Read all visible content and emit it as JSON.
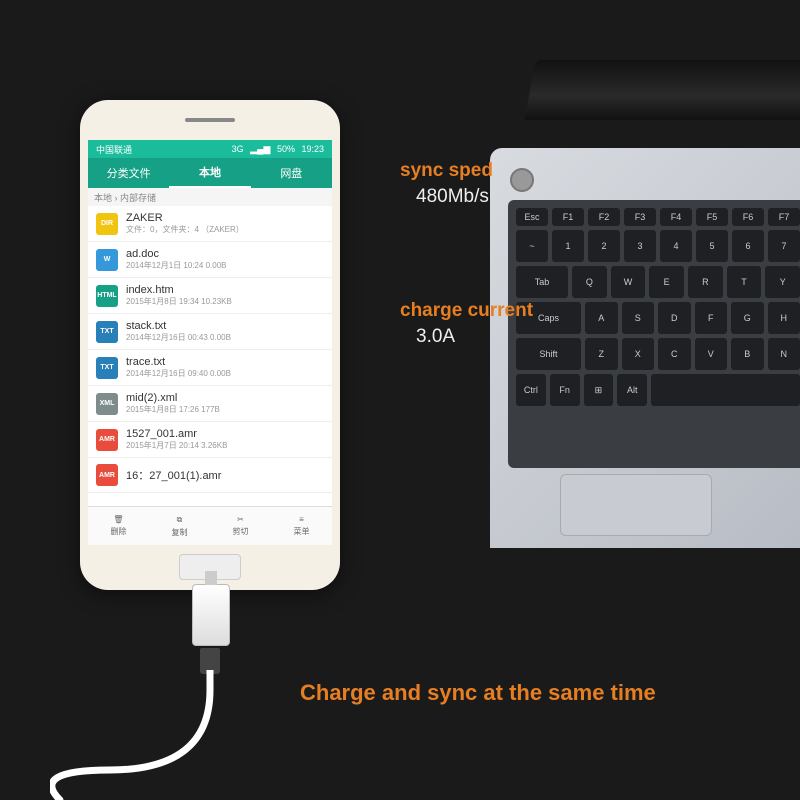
{
  "spec1": {
    "label": "sync sped",
    "value": "480Mb/s"
  },
  "spec2": {
    "label": "charge current",
    "value": "3.0A"
  },
  "tagline": "Charge and sync at the same time",
  "phone": {
    "status": {
      "carrier": "中国联通",
      "network": "3G",
      "signal": "50%",
      "time": "19:23"
    },
    "tabs": [
      "分类文件",
      "本地",
      "网盘"
    ],
    "crumb": "本地 › 内部存储",
    "files": [
      {
        "icon": "DIR",
        "color": "#f1c40f",
        "name": "ZAKER",
        "meta": "文件：0，文件夹：4 （ZAKER）"
      },
      {
        "icon": "W",
        "color": "#3498db",
        "name": "ad.doc",
        "meta": "2014年12月1日 10:24 0.00B"
      },
      {
        "icon": "HTML",
        "color": "#16a085",
        "name": "index.htm",
        "meta": "2015年1月8日 19:34 10.23KB"
      },
      {
        "icon": "TXT",
        "color": "#2980b9",
        "name": "stack.txt",
        "meta": "2014年12月16日 00:43 0.00B"
      },
      {
        "icon": "TXT",
        "color": "#2980b9",
        "name": "trace.txt",
        "meta": "2014年12月16日 09:40 0.00B"
      },
      {
        "icon": "XML",
        "color": "#7f8c8d",
        "name": "mid(2).xml",
        "meta": "2015年1月8日 17:26 177B"
      },
      {
        "icon": "AMR",
        "color": "#e74c3c",
        "name": "1527_001.amr",
        "meta": "2015年1月7日 20:14 3.26KB"
      },
      {
        "icon": "AMR",
        "color": "#e74c3c",
        "name": "16：27_001(1).amr",
        "meta": ""
      }
    ],
    "actions": [
      "删除",
      "复制",
      "剪切",
      "菜单"
    ]
  },
  "keys": {
    "fn": [
      "Esc",
      "F1",
      "F2",
      "F3",
      "F4",
      "F5",
      "F6",
      "F7"
    ],
    "r1": [
      "~",
      "1",
      "2",
      "3",
      "4",
      "5",
      "6",
      "7"
    ],
    "r2": [
      "Tab",
      "Q",
      "W",
      "E",
      "R",
      "T",
      "Y"
    ],
    "r3": [
      "Caps",
      "A",
      "S",
      "D",
      "F",
      "G",
      "H"
    ],
    "r4": [
      "Shift",
      "Z",
      "X",
      "C",
      "V",
      "B",
      "N"
    ],
    "r5": [
      "Ctrl",
      "Fn",
      "⊞",
      "Alt",
      ""
    ]
  }
}
